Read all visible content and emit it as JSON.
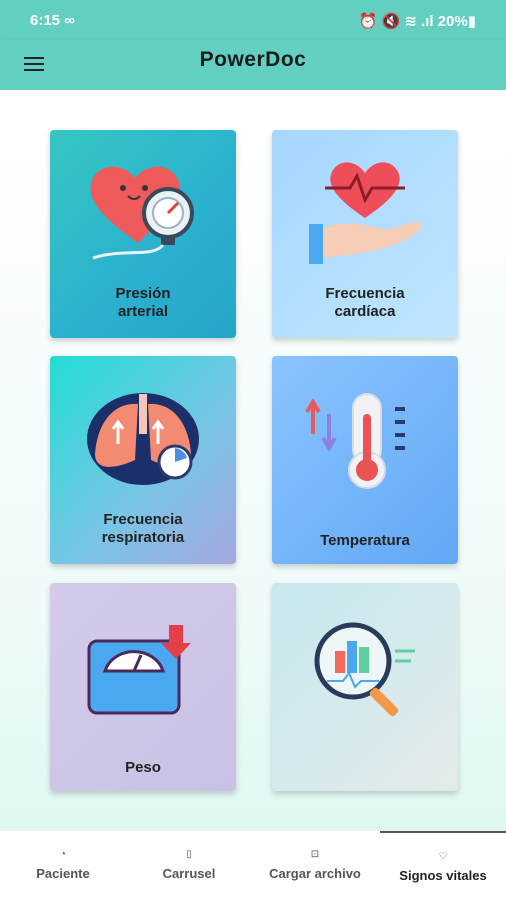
{
  "status": {
    "time": "6:15 ∞",
    "right": "⏰ 🔇 ≋ .ıl 20%▮"
  },
  "appbar": {
    "title": "PowerDoc"
  },
  "cards": [
    {
      "label": "Presión arterial",
      "line1": "Presión",
      "line2": "arterial"
    },
    {
      "label": "Frecuencia cardíaca",
      "line1": "Frecuencia",
      "line2": "cardíaca"
    },
    {
      "label": "Frecuencia respiratoria",
      "line1": "Frecuencia",
      "line2": "respiratoria"
    },
    {
      "label": "Temperatura",
      "line1": "Temperatura",
      "line2": ""
    },
    {
      "label": "Peso",
      "line1": "Peso",
      "line2": ""
    },
    {
      "label": "",
      "line1": "",
      "line2": ""
    }
  ],
  "nav": [
    {
      "label": "Paciente",
      "icon": "person-icon"
    },
    {
      "label": "Carrusel",
      "icon": "carousel-icon"
    },
    {
      "label": "Cargar archivo",
      "icon": "upload-icon"
    },
    {
      "label": "Signos vitales",
      "icon": "vitals-icon"
    }
  ],
  "colors": {
    "appbar": "#63cfc0",
    "accent": "#23a5c8"
  }
}
